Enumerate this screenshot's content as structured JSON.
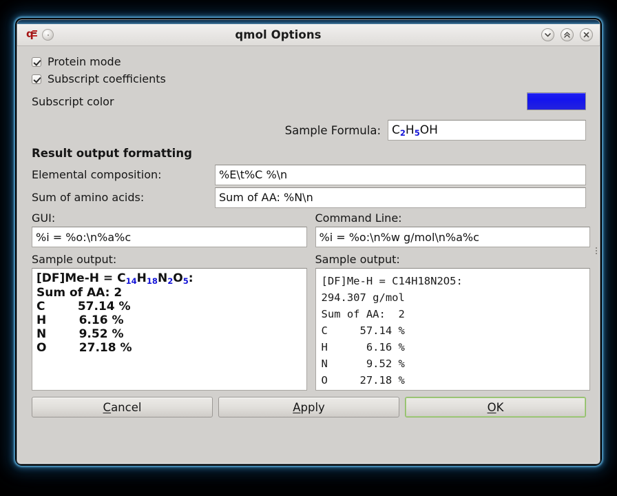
{
  "window": {
    "title": "qmol Options",
    "icon": "qmol-app-icon",
    "controls": {
      "minimize": "minimize-icon",
      "maximize": "maximize-icon",
      "close": "close-icon"
    }
  },
  "options": {
    "protein_mode": {
      "label": "Protein mode",
      "checked": true
    },
    "subscript_coefficients": {
      "label": "Subscript coefficients",
      "checked": true
    },
    "subscript_color": {
      "label": "Subscript color",
      "value": "#1414EE"
    }
  },
  "sample_formula": {
    "label": "Sample Formula:",
    "value_main_1": "C",
    "value_sub_1": "2",
    "value_main_2": "H",
    "value_sub_2": "5",
    "value_main_3": "OH",
    "value_plain": "C2H5OH"
  },
  "result_formatting": {
    "section_title": "Result output formatting",
    "elemental_composition": {
      "label": "Elemental composition:",
      "value": "%E\\t%C %\\n"
    },
    "amino_acid_sum": {
      "label": "Sum of amino acids:",
      "value": "Sum of AA: %N\\n"
    },
    "gui": {
      "label": "GUI:",
      "value": "%i = %o:\\n%a%c"
    },
    "command_line": {
      "label": "Command Line:",
      "value": "%i = %o:\\n%w g/mol\\n%a%c"
    }
  },
  "gui_output": {
    "label": "Sample output:",
    "formula_prefix": "[DF]Me-H = C",
    "formula_sub_1": "14",
    "formula_mid_1": "H",
    "formula_sub_2": "18",
    "formula_mid_2": "N",
    "formula_sub_3": "2",
    "formula_mid_3": "O",
    "formula_sub_4": "5",
    "formula_suffix": ":",
    "lines": [
      "Sum of AA: 2",
      "C        57.14 %",
      "H        6.16 %",
      "N        9.52 %",
      "O        27.18 %"
    ]
  },
  "cli_output": {
    "label": "Sample output:",
    "lines": [
      "[DF]Me-H = C14H18N2O5:",
      "294.307 g/mol",
      "Sum of AA:  2",
      "C     57.14 %",
      "H      6.16 %",
      "N      9.52 %",
      "O     27.18 %"
    ]
  },
  "buttons": {
    "cancel": {
      "mnemonic": "C",
      "rest": "ancel"
    },
    "apply": {
      "mnemonic": "A",
      "rest": "pply"
    },
    "ok": {
      "mnemonic": "O",
      "rest": "K",
      "focused": true
    }
  }
}
